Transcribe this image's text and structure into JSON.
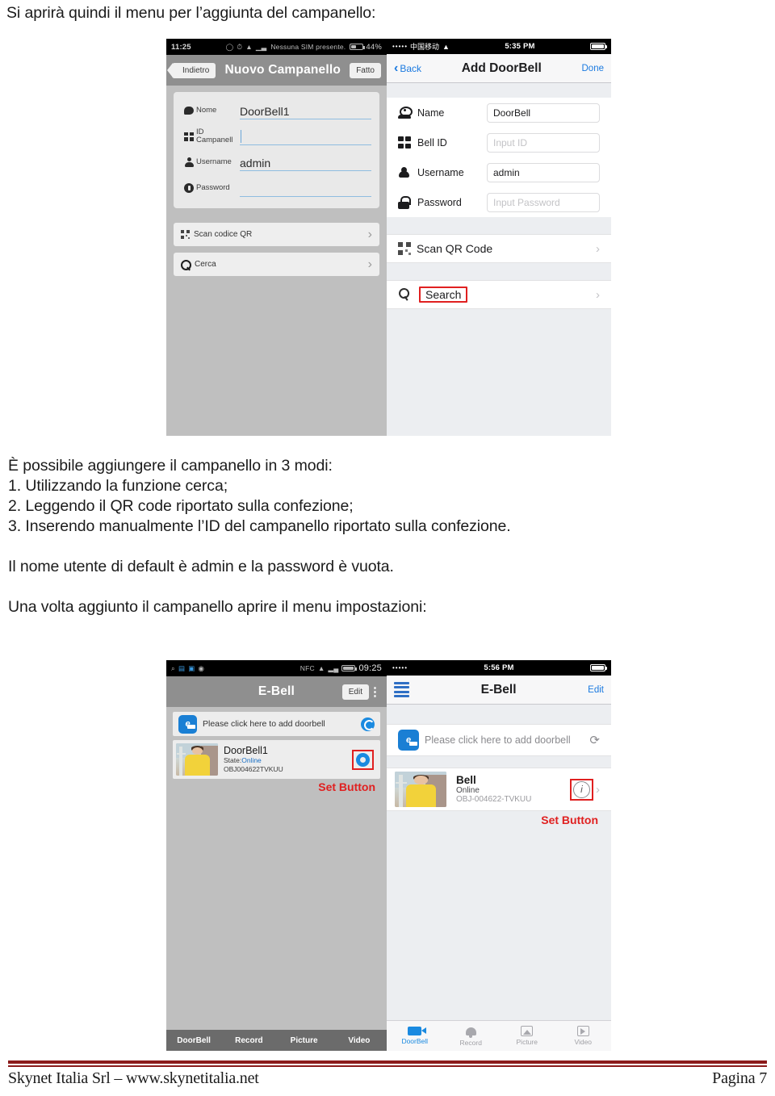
{
  "document": {
    "intro": "Si aprirà quindi il menu per l’aggiunta del campanello:",
    "middle": [
      "È possibile aggiungere il campanello in 3 modi:",
      "1. Utilizzando la funzione cerca;",
      "2. Leggendo il QR code riportato sulla confezione;",
      "3. Inserendo manualmente l’ID del campanello riportato sulla confezione.",
      "Il nome utente di default è admin e la password è vuota.",
      "Una volta aggiunto il campanello aprire il menu impostazioni:"
    ]
  },
  "footer": {
    "left": "Skynet Italia Srl – www.skynetitalia.net",
    "right": "Pagina 7",
    "rule_color": "#8B1A1A"
  },
  "screenshot_add": {
    "android": {
      "status": {
        "time": "11:25",
        "sim_text": "Nessuna SIM presente.",
        "battery": "44%"
      },
      "nav": {
        "back": "Indietro",
        "title": "Nuovo Campanello",
        "done": "Fatto"
      },
      "fields": [
        {
          "icon": "chat-icon",
          "label": "Nome",
          "value": "DoorBell1"
        },
        {
          "icon": "grid-icon",
          "label": "ID Campanell",
          "value": ""
        },
        {
          "icon": "user-icon",
          "label": "Username",
          "value": "admin"
        },
        {
          "icon": "lock-icon",
          "label": "Password",
          "value": ""
        }
      ],
      "actions": [
        {
          "icon": "qr-icon",
          "label": "Scan codice QR"
        },
        {
          "icon": "search-icon",
          "label": "Cerca"
        }
      ]
    },
    "ios": {
      "status": {
        "dots": "•••••",
        "carrier": "中国移动",
        "time": "5:35 PM"
      },
      "nav": {
        "back": "Back",
        "title": "Add DoorBell",
        "done": "Done"
      },
      "fields": [
        {
          "icon": "camera-icon",
          "label": "Name",
          "value": "DoorBell",
          "is_placeholder": false
        },
        {
          "icon": "grid-icon",
          "label": "Bell ID",
          "value": "Input ID",
          "is_placeholder": true
        },
        {
          "icon": "person-icon",
          "label": "Username",
          "value": "admin",
          "is_placeholder": false
        },
        {
          "icon": "lock-icon",
          "label": "Password",
          "value": "Input Password",
          "is_placeholder": true
        }
      ],
      "actions": [
        {
          "icon": "qr-icon",
          "label": "Scan QR Code",
          "highlighted": false
        },
        {
          "icon": "magnifier-icon",
          "label": "Search",
          "highlighted": true
        }
      ]
    }
  },
  "screenshot_list": {
    "android": {
      "status": {
        "time": "09:25"
      },
      "nav": {
        "title": "E-Bell",
        "edit": "Edit",
        "overflow": "⋮"
      },
      "add_row": {
        "badge": "e",
        "text": "Please click here to add doorbell"
      },
      "device": {
        "name": "DoorBell1",
        "state_label": "State:",
        "state_value": "Online",
        "id": "OBJ004622TVKUU",
        "annotation": "Set Button"
      },
      "tabs": [
        "DoorBell",
        "Record",
        "Picture",
        "Video"
      ]
    },
    "ios": {
      "status": {
        "dots": "•••••",
        "time": "5:56 PM"
      },
      "nav": {
        "title": "E-Bell",
        "edit": "Edit"
      },
      "add_row": {
        "badge": "e",
        "text": "Please click here to add doorbell"
      },
      "device": {
        "name": "Bell",
        "state_value": "Online",
        "id": "OBJ-004622-TVKUU",
        "annotation": "Set Button"
      },
      "tabs": [
        {
          "label": "DoorBell",
          "icon": "video-camera-icon",
          "active": true
        },
        {
          "label": "Record",
          "icon": "bell-icon",
          "active": false
        },
        {
          "label": "Picture",
          "icon": "picture-icon",
          "active": false
        },
        {
          "label": "Video",
          "icon": "play-icon",
          "active": false
        }
      ]
    }
  }
}
